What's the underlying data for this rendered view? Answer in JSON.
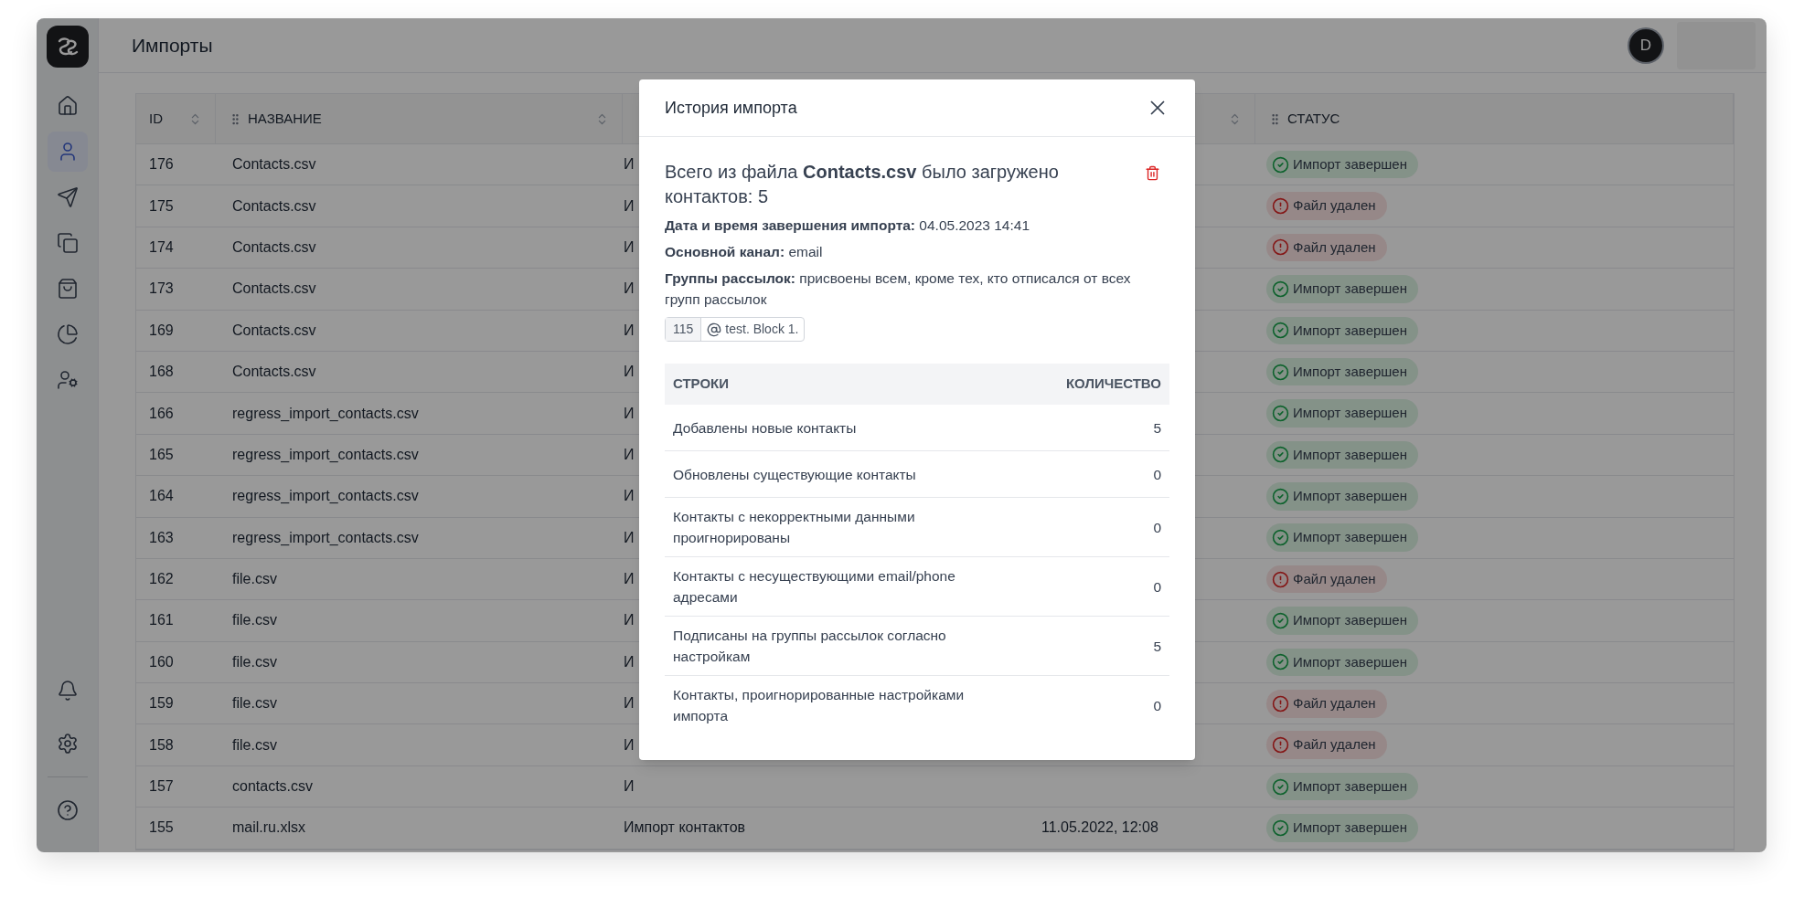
{
  "header": {
    "title": "Импорты",
    "avatar": "D"
  },
  "sidebar": {
    "items": [
      {
        "selected": false
      },
      {
        "selected": true
      },
      {
        "selected": false
      },
      {
        "selected": false
      },
      {
        "selected": false
      },
      {
        "selected": false
      },
      {
        "selected": false
      }
    ],
    "bottom_items": [
      {
        "selected": false
      },
      {
        "selected": false
      },
      {
        "selected": false
      }
    ]
  },
  "table": {
    "columns": [
      "ID",
      "НАЗВАНИЕ",
      "",
      "",
      "СТАТУС"
    ],
    "rows": [
      {
        "id": "176",
        "name": "Contacts.csv",
        "column_3": "И",
        "column_4": "",
        "status": {
          "kind": "done",
          "label": "Импорт завершен"
        }
      },
      {
        "id": "175",
        "name": "Contacts.csv",
        "column_3": "И",
        "column_4": "",
        "status": {
          "kind": "deleted",
          "label": "Файл удален"
        }
      },
      {
        "id": "174",
        "name": "Contacts.csv",
        "column_3": "И",
        "column_4": "",
        "status": {
          "kind": "deleted",
          "label": "Файл удален"
        }
      },
      {
        "id": "173",
        "name": "Contacts.csv",
        "column_3": "И",
        "column_4": "",
        "status": {
          "kind": "done",
          "label": "Импорт завершен"
        }
      },
      {
        "id": "169",
        "name": "Contacts.csv",
        "column_3": "И",
        "column_4": "",
        "status": {
          "kind": "done",
          "label": "Импорт завершен"
        }
      },
      {
        "id": "168",
        "name": "Contacts.csv",
        "column_3": "И",
        "column_4": "",
        "status": {
          "kind": "done",
          "label": "Импорт завершен"
        }
      },
      {
        "id": "166",
        "name": "regress_import_contacts.csv",
        "column_3": "И",
        "column_4": "",
        "status": {
          "kind": "done",
          "label": "Импорт завершен"
        }
      },
      {
        "id": "165",
        "name": "regress_import_contacts.csv",
        "column_3": "И",
        "column_4": "",
        "status": {
          "kind": "done",
          "label": "Импорт завершен"
        }
      },
      {
        "id": "164",
        "name": "regress_import_contacts.csv",
        "column_3": "И",
        "column_4": "",
        "status": {
          "kind": "done",
          "label": "Импорт завершен"
        }
      },
      {
        "id": "163",
        "name": "regress_import_contacts.csv",
        "column_3": "И",
        "column_4": "",
        "status": {
          "kind": "done",
          "label": "Импорт завершен"
        }
      },
      {
        "id": "162",
        "name": "file.csv",
        "column_3": "И",
        "column_4": "",
        "status": {
          "kind": "deleted",
          "label": "Файл удален"
        }
      },
      {
        "id": "161",
        "name": "file.csv",
        "column_3": "И",
        "column_4": "",
        "status": {
          "kind": "done",
          "label": "Импорт завершен"
        }
      },
      {
        "id": "160",
        "name": "file.csv",
        "column_3": "И",
        "column_4": "",
        "status": {
          "kind": "done",
          "label": "Импорт завершен"
        }
      },
      {
        "id": "159",
        "name": "file.csv",
        "column_3": "И",
        "column_4": "",
        "status": {
          "kind": "deleted",
          "label": "Файл удален"
        }
      },
      {
        "id": "158",
        "name": "file.csv",
        "column_3": "И",
        "column_4": "",
        "status": {
          "kind": "deleted",
          "label": "Файл удален"
        }
      },
      {
        "id": "157",
        "name": "contacts.csv",
        "column_3": "И",
        "column_4": "",
        "status": {
          "kind": "done",
          "label": "Импорт завершен"
        }
      },
      {
        "id": "155",
        "name": "mail.ru.xlsx",
        "column_3": "Импорт контактов",
        "column_4": "11.05.2022, 12:08",
        "status": {
          "kind": "done",
          "label": "Импорт завершен"
        }
      }
    ]
  },
  "modal": {
    "title": "История импорта",
    "summary": "Всего из файла **Contacts.csv** было загружено контактов: 5",
    "details": [
      "**Дата и время завершения импорта:** 04.05.2023 14:41",
      "**Основной канал:** email",
      "**Группы рассылок:** присвоены всем, кроме тех, кто отписался от всех групп рассылок"
    ],
    "group_tag": {
      "count": "115",
      "name": "test. Block 1."
    },
    "stats": {
      "columns": [
        "СТРОКИ",
        "КОЛИЧЕСТВО"
      ],
      "rows": [
        {
          "label": "Добавлены новые контакты",
          "count": "5"
        },
        {
          "label": "Обновлены существующие контакты",
          "count": "0"
        },
        {
          "label": "Контакты с некорректными данными проигнорированы",
          "count": "0"
        },
        {
          "label": "Контакты с несуществующими email/phone адресами",
          "count": "0"
        },
        {
          "label": "Подписаны на группы рассылок согласно настройкам",
          "count": "5"
        },
        {
          "label": "Контакты, проигнорированные настройками импорта",
          "count": "0"
        }
      ]
    }
  }
}
